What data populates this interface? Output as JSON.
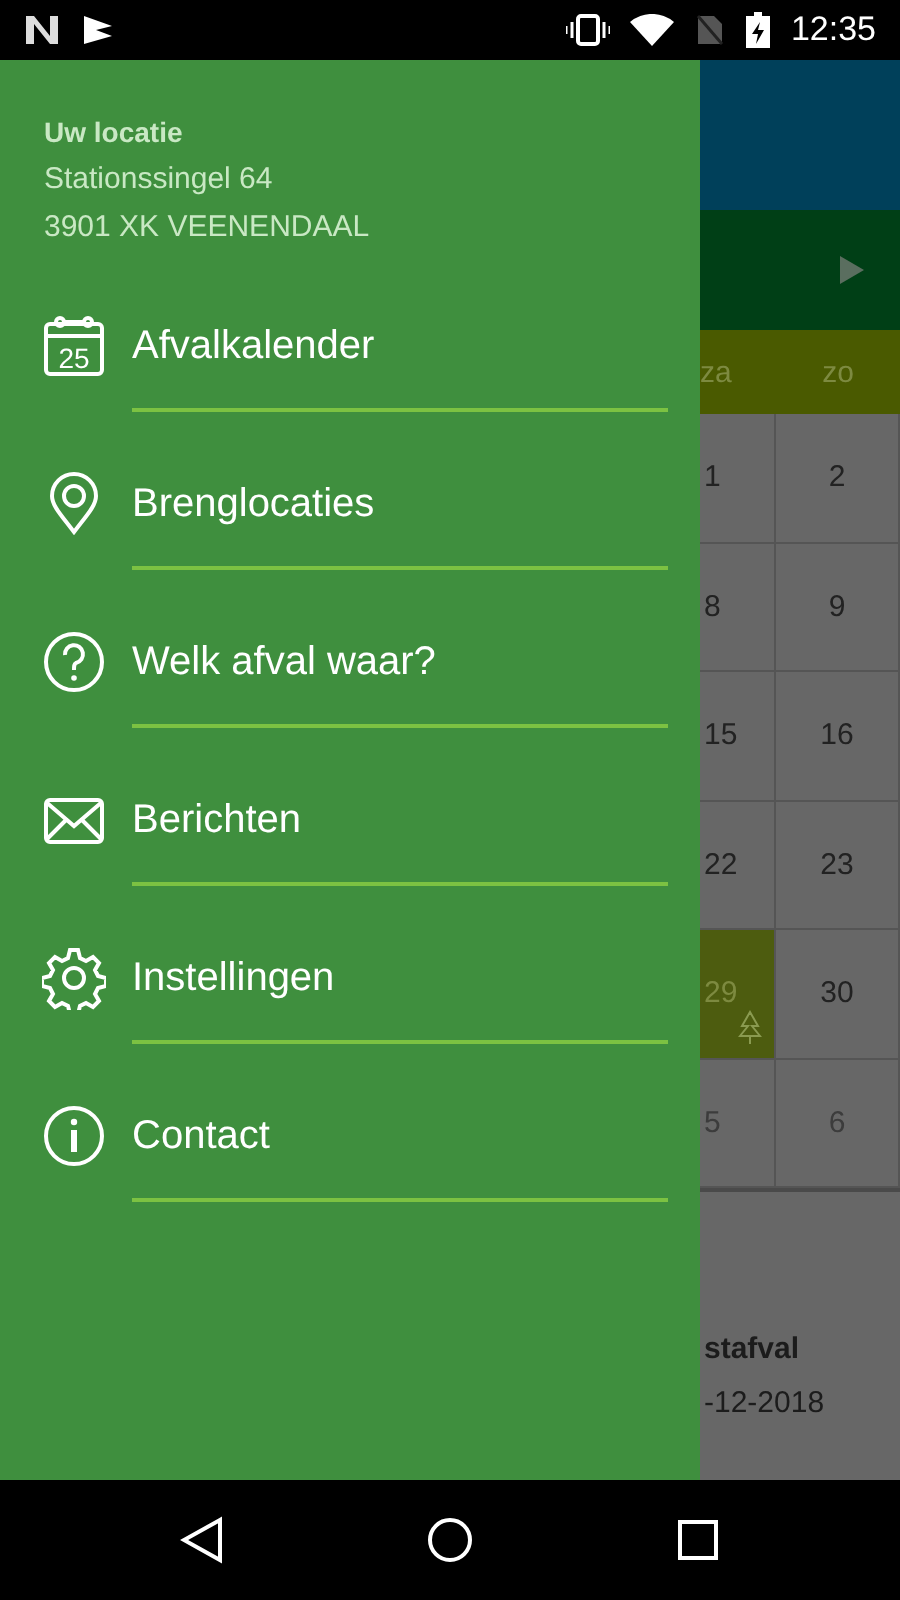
{
  "status_bar": {
    "time": "12:35"
  },
  "calendar": {
    "day_headers": [
      "za",
      "zo"
    ],
    "weeks": [
      [
        {
          "day": "1",
          "muted": false,
          "highlight": false
        },
        {
          "day": "2",
          "muted": false,
          "highlight": false
        }
      ],
      [
        {
          "day": "8",
          "muted": false,
          "highlight": false
        },
        {
          "day": "9",
          "muted": false,
          "highlight": false
        }
      ],
      [
        {
          "day": "15",
          "muted": false,
          "highlight": false
        },
        {
          "day": "16",
          "muted": false,
          "highlight": false
        }
      ],
      [
        {
          "day": "22",
          "muted": false,
          "highlight": false
        },
        {
          "day": "23",
          "muted": false,
          "highlight": false
        }
      ],
      [
        {
          "day": "29",
          "muted": false,
          "highlight": true
        },
        {
          "day": "30",
          "muted": false,
          "highlight": false
        }
      ],
      [
        {
          "day": "5",
          "muted": true,
          "highlight": false
        },
        {
          "day": "6",
          "muted": true,
          "highlight": false
        }
      ]
    ],
    "event": {
      "title": "stafval",
      "date": "-12-2018"
    }
  },
  "drawer": {
    "location_label": "Uw locatie",
    "address_lines": [
      "Stationssingel 64",
      "3901 XK VEENENDAAL"
    ],
    "items": [
      {
        "label": "Afvalkalender",
        "kind": "calendar",
        "icon_text": "25"
      },
      {
        "label": "Brenglocaties",
        "kind": "pin"
      },
      {
        "label": "Welk afval waar?",
        "kind": "question"
      },
      {
        "label": "Berichten",
        "kind": "mail"
      },
      {
        "label": "Instellingen",
        "kind": "gear"
      },
      {
        "label": "Contact",
        "kind": "info"
      }
    ]
  }
}
